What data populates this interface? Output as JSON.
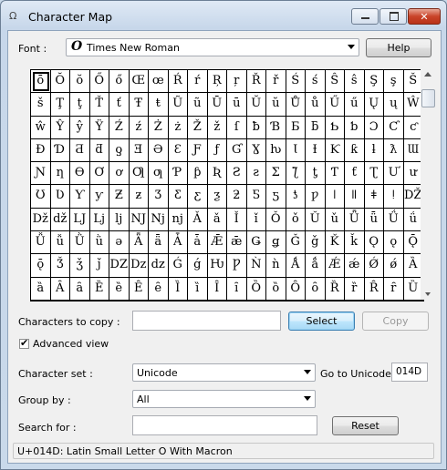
{
  "window": {
    "title": "Character Map"
  },
  "font": {
    "label": "Font :",
    "value": "Times New Roman",
    "icon": "opentype-font-icon"
  },
  "help_button": "Help",
  "characters": [
    "ō",
    "Ŏ",
    "ŏ",
    "Ő",
    "ő",
    "Œ",
    "œ",
    "Ŕ",
    "ŕ",
    "Ŗ",
    "ŗ",
    "Ř",
    "ř",
    "Ś",
    "ś",
    "Ŝ",
    "ŝ",
    "Ş",
    "ş",
    "Š",
    "š",
    "Ţ",
    "ţ",
    "Ť",
    "ť",
    "Ŧ",
    "ŧ",
    "Ũ",
    "ũ",
    "Ū",
    "ū",
    "Ŭ",
    "ŭ",
    "Ů",
    "ů",
    "Ű",
    "ű",
    "Ų",
    "ų",
    "Ŵ",
    "ŵ",
    "Ŷ",
    "ŷ",
    "Ÿ",
    "Ź",
    "ź",
    "Ż",
    "ż",
    "Ž",
    "ž",
    "ſ",
    "ƀ",
    "Ɓ",
    "Ƃ",
    "ƃ",
    "Ƅ",
    "ƅ",
    "Ɔ",
    "Ƈ",
    "ƈ",
    "Ɖ",
    "Ɗ",
    "Ƌ",
    "ƌ",
    "ƍ",
    "Ǝ",
    "Ə",
    "Ɛ",
    "Ƒ",
    "ƒ",
    "Ɠ",
    "Ɣ",
    "ƕ",
    "Ɩ",
    "Ɨ",
    "Ƙ",
    "ƙ",
    "ƚ",
    "ƛ",
    "Ɯ",
    "Ɲ",
    "ƞ",
    "Ɵ",
    "Ơ",
    "ơ",
    "Ƣ",
    "ƣ",
    "Ƥ",
    "ƥ",
    "Ʀ",
    "Ƨ",
    "ƨ",
    "Ʃ",
    "ƪ",
    "ƫ",
    "Ƭ",
    "ƭ",
    "Ʈ",
    "Ư",
    "ư",
    "Ʊ",
    "Ʋ",
    "Ƴ",
    "ƴ",
    "Ƶ",
    "ƶ",
    "Ʒ",
    "Ƹ",
    "ƹ",
    "ƺ",
    "ƻ",
    "Ƽ",
    "ƽ",
    "ƾ",
    "ƿ",
    "ǀ",
    "ǁ",
    "ǂ",
    "ǃ",
    "Ǆ",
    "ǅ",
    "ǆ",
    "Ǉ",
    "ǈ",
    "ǉ",
    "Ǌ",
    "ǋ",
    "ǌ",
    "Ǎ",
    "ǎ",
    "Ǐ",
    "ǐ",
    "Ǒ",
    "ǒ",
    "Ǔ",
    "ǔ",
    "Ǖ",
    "ǖ",
    "Ǘ",
    "ǘ",
    "Ǚ",
    "ǚ",
    "Ǜ",
    "ǜ",
    "ǝ",
    "Ǟ",
    "ǟ",
    "Ǡ",
    "ǡ",
    "Ǣ",
    "ǣ",
    "Ǥ",
    "ǥ",
    "Ǧ",
    "ǧ",
    "Ǩ",
    "ǩ",
    "Ǫ",
    "ǫ",
    "Ǭ",
    "ǭ",
    "Ǯ",
    "ǯ",
    "ǰ",
    "Ǳ",
    "ǲ",
    "ǳ",
    "Ǵ",
    "ǵ",
    "Ƕ",
    "Ƿ",
    "Ǹ",
    "ǹ",
    "Ǻ",
    "ǻ",
    "Ǽ",
    "ǽ",
    "Ǿ",
    "ǿ",
    "Ȁ",
    "ȁ",
    "Ȃ",
    "ȃ",
    "Ȅ",
    "ȅ",
    "Ȇ",
    "ȇ",
    "Ȉ",
    "ȉ",
    "Ȋ",
    "ȋ",
    "Ȍ",
    "ȍ",
    "Ȏ",
    "ȏ",
    "Ȑ",
    "ȑ",
    "Ȓ",
    "ȓ",
    "Ȕ"
  ],
  "copy": {
    "label": "Characters to copy :",
    "value": "",
    "select_button": "Select",
    "copy_button": "Copy"
  },
  "advanced": {
    "label": "Advanced view",
    "checked": true
  },
  "charset": {
    "label": "Character set :",
    "value": "Unicode"
  },
  "goto": {
    "label": "Go to Unicode :",
    "value": "014D"
  },
  "groupby": {
    "label": "Group by :",
    "value": "All"
  },
  "search": {
    "label": "Search for :",
    "value": "",
    "reset_button": "Reset"
  },
  "status": "U+014D: Latin Small Letter O With Macron"
}
